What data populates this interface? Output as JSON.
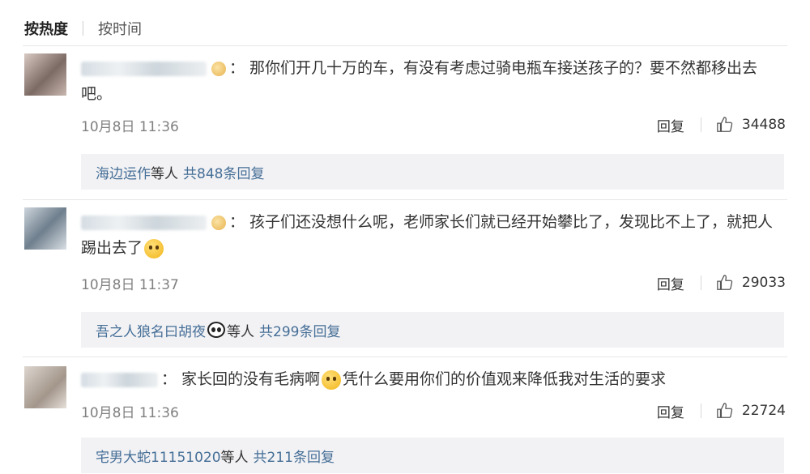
{
  "tabs": [
    {
      "label": "按热度",
      "active": true
    },
    {
      "label": "按时间",
      "active": false
    }
  ],
  "comments": [
    {
      "separator": "：",
      "text_before": "那你们开几十万的车，有没有考虑过骑电瓶车接送孩子的？要不然都移出去吧。",
      "text_after": "",
      "has_emoji": false,
      "time": "10月8日 11:36",
      "reply_label": "回复",
      "likes": "34488",
      "replies": {
        "who": "海边运作",
        "suffix": "等人",
        "count_text": "共848条回复",
        "emoji": ""
      }
    },
    {
      "separator": "：",
      "text_before": "孩子们还没想什么呢，老师家长们就已经开始攀比了，发现比不上了，就把人踢出去了",
      "text_after": "",
      "has_emoji": true,
      "time": "10月8日 11:37",
      "reply_label": "回复",
      "likes": "29033",
      "replies": {
        "who": "吾之人狼名曰胡夜",
        "suffix": "等人",
        "count_text": "共299条回复",
        "emoji": "panda"
      }
    },
    {
      "separator": "：",
      "text_before": "家长回的没有毛病啊",
      "text_after": "凭什么要用你们的价值观来降低我对生活的要求",
      "has_emoji": true,
      "time": "10月8日 11:36",
      "reply_label": "回复",
      "likes": "22724",
      "replies": {
        "who": "宅男大蛇11151020",
        "suffix": "等人",
        "count_text": "共211条回复",
        "emoji": ""
      }
    }
  ],
  "icons": {
    "like": "thumbs-up-icon",
    "badge": "crown-badge-icon",
    "emoji_comment2": "cat-face-emoji",
    "emoji_comment3": "smile-emoji",
    "emoji_replies2": "panda-emoji"
  },
  "colors": {
    "link": "#456e96",
    "meta": "#808080",
    "reply_bg": "#f2f2f5"
  }
}
